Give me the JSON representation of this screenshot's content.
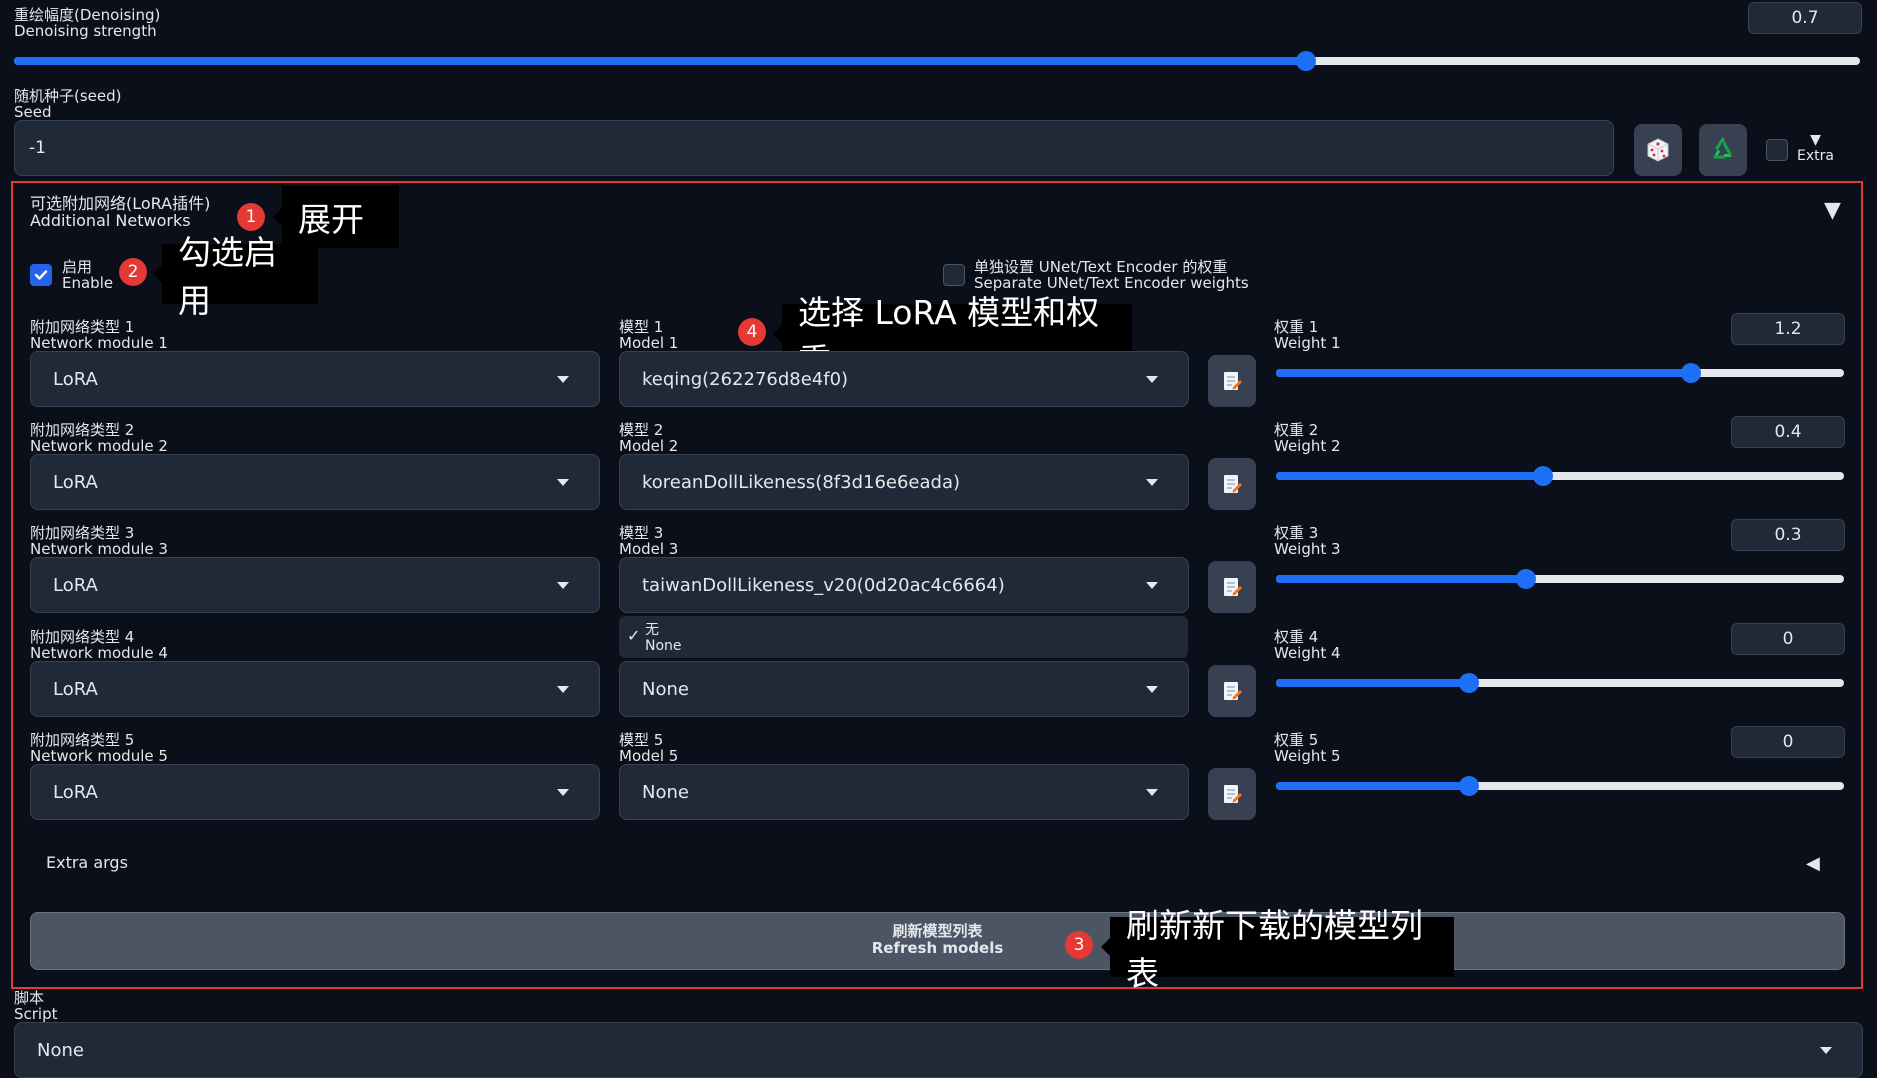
{
  "denoising": {
    "label_cn": "重绘幅度(Denoising)",
    "label_en": "Denoising strength",
    "value": "0.7",
    "fraction": 0.7
  },
  "seed": {
    "label_cn": "随机种子(seed)",
    "label_en": "Seed",
    "value": "-1",
    "extra_label": "Extra",
    "extra_arrow": "▼"
  },
  "additional_networks": {
    "title_cn": "可选附加网络(LoRA插件)",
    "title_en": "Additional Networks",
    "collapse_arrow": "▼",
    "enable_cn": "启用",
    "enable_en": "Enable",
    "enable_checked": true,
    "separate_cn": "单独设置 UNet/Text Encoder 的权重",
    "separate_en": "Separate UNet/Text Encoder weights",
    "separate_checked": false,
    "rows": [
      {
        "module_cn": "附加网络类型 1",
        "module_en": "Network module 1",
        "module_value": "LoRA",
        "model_cn": "模型 1",
        "model_en": "Model 1",
        "model_value": "keqing(262276d8e4f0)",
        "weight_cn": "权重 1",
        "weight_en": "Weight 1",
        "weight_value": "1.2",
        "weight_fraction": 0.73
      },
      {
        "module_cn": "附加网络类型 2",
        "module_en": "Network module 2",
        "module_value": "LoRA",
        "model_cn": "模型 2",
        "model_en": "Model 2",
        "model_value": "koreanDollLikeness(8f3d16e6eada)",
        "weight_cn": "权重 2",
        "weight_en": "Weight 2",
        "weight_value": "0.4",
        "weight_fraction": 0.47
      },
      {
        "module_cn": "附加网络类型 3",
        "module_en": "Network module 3",
        "module_value": "LoRA",
        "model_cn": "模型 3",
        "model_en": "Model 3",
        "model_value": "taiwanDollLikeness_v20(0d20ac4c6664)",
        "weight_cn": "权重 3",
        "weight_en": "Weight 3",
        "weight_value": "0.3",
        "weight_fraction": 0.44
      },
      {
        "module_cn": "附加网络类型 4",
        "module_en": "Network module 4",
        "module_value": "LoRA",
        "model_cn": "",
        "model_en": "",
        "model_value": "None",
        "weight_cn": "权重 4",
        "weight_en": "Weight 4",
        "weight_value": "0",
        "weight_fraction": 0.34
      },
      {
        "module_cn": "附加网络类型 5",
        "module_en": "Network module 5",
        "module_value": "LoRA",
        "model_cn": "模型 5",
        "model_en": "Model 5",
        "model_value": "None",
        "weight_cn": "权重 5",
        "weight_en": "Weight 5",
        "weight_value": "0",
        "weight_fraction": 0.34
      }
    ],
    "dropdown_option": {
      "check": "✓",
      "cn": "无",
      "en": "None"
    },
    "extra_args": "Extra args",
    "extra_args_arrow": "◀",
    "refresh_cn": "刷新模型列表",
    "refresh_en": "Refresh models"
  },
  "script": {
    "label_cn": "脚本",
    "label_en": "Script",
    "value": "None"
  },
  "annotations": [
    {
      "num": "1",
      "text": "展开"
    },
    {
      "num": "2",
      "text": "勾选启用"
    },
    {
      "num": "3",
      "text": "刷新新下载的模型列表"
    },
    {
      "num": "4",
      "text": "选择 LoRA 模型和权重"
    }
  ],
  "colors": {
    "background": "#0b0f19",
    "accent": "#1d6ff5",
    "highlight_border": "#e53935",
    "badge": "#e53935"
  }
}
